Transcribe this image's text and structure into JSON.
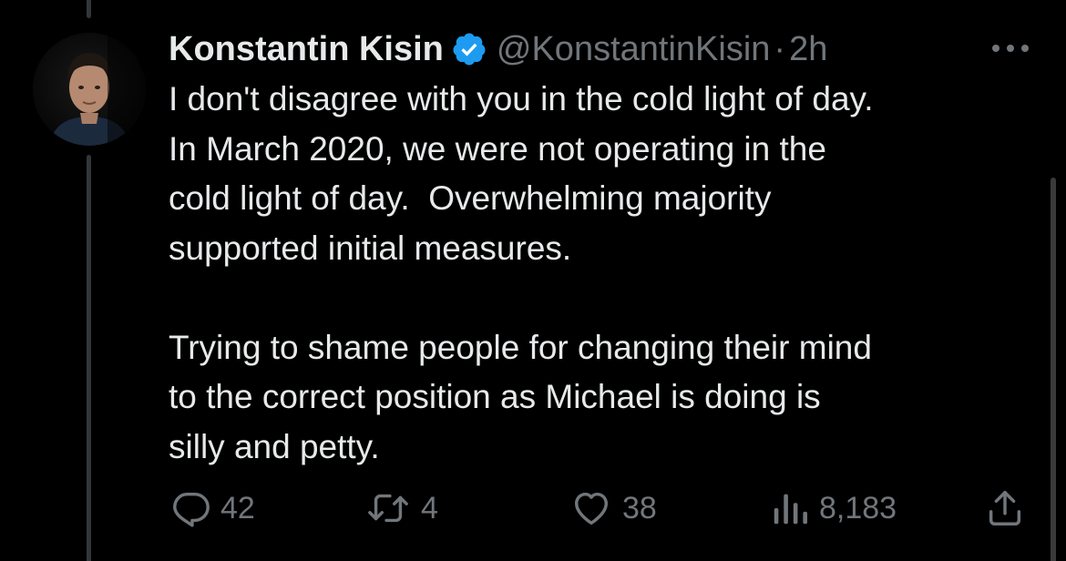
{
  "tweet": {
    "author": {
      "display_name": "Konstantin Kisin",
      "handle": "@KonstantinKisin",
      "verified": true
    },
    "separator": "·",
    "timestamp": "2h",
    "text": "I don't disagree with you in the cold light of day.\nIn March 2020, we were not operating in the\ncold light of day.  Overwhelming majority\nsupported initial measures.\n\nTrying to shame people for changing their mind\nto the correct position as Michael is doing is\nsilly and petty.",
    "actions": {
      "replies": "42",
      "retweets": "4",
      "likes": "38",
      "views": "8,183"
    }
  },
  "colors": {
    "background": "#000000",
    "text_primary": "#e7e9ea",
    "text_secondary": "#71767b",
    "verified_badge": "#1d9bf0",
    "thread_line": "#333639"
  },
  "icons": {
    "verified": "verified-badge-icon",
    "more": "more-dots-icon",
    "reply": "reply-bubble-icon",
    "retweet": "retweet-icon",
    "like": "heart-icon",
    "views": "views-bars-icon",
    "share": "share-upload-icon"
  }
}
